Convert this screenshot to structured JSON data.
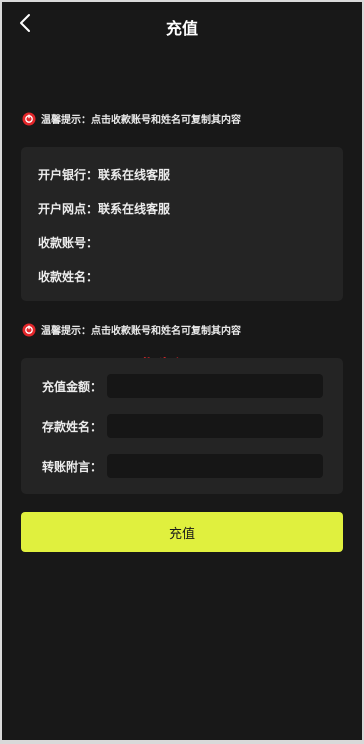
{
  "header": {
    "title": "充值"
  },
  "tip": {
    "text": "温馨提示：点击收款账号和姓名可复制其内容",
    "icon": "warning-icon",
    "icon_color": "#e3262a"
  },
  "bank_info": {
    "rows": [
      {
        "label": "开户银行：",
        "value": "联系在线客服"
      },
      {
        "label": "开户网点：",
        "value": "联系在线客服"
      },
      {
        "label": "收款账号：",
        "value": ""
      },
      {
        "label": "收款姓名：",
        "value": ""
      }
    ]
  },
  "form": {
    "fields": [
      {
        "label": "充值金额：",
        "value": "",
        "placeholder": ""
      },
      {
        "label": "存款姓名：",
        "value": "",
        "placeholder": ""
      },
      {
        "label": "转账附言：",
        "value": "",
        "placeholder": ""
      }
    ]
  },
  "watermark": {
    "text": "华为源码",
    "color": "#e3262a"
  },
  "submit": {
    "label": "充值",
    "color": "#e0f03e"
  }
}
